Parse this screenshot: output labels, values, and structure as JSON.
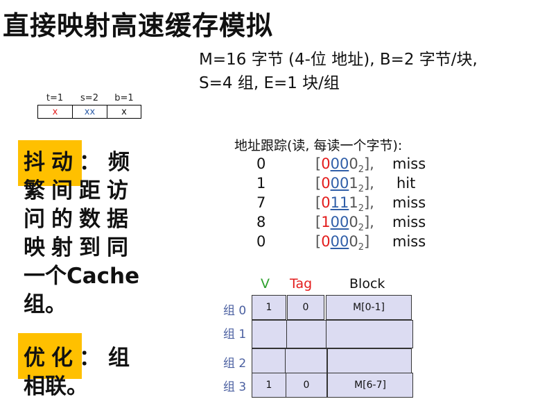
{
  "slide": {
    "title": "直接映射高速缓存模拟",
    "params_line1": "M=16 字节 (4-位 地址), B=2 字节/块,",
    "params_line2": "S=4 组, E=1 块/组"
  },
  "address_field": {
    "labels": [
      "t=1",
      "s=2",
      "b=1"
    ],
    "values": [
      "x",
      "xx",
      "x"
    ],
    "colors": [
      "#e31c1c",
      "#2f5ea8",
      "#111111"
    ]
  },
  "explanation": {
    "thrash_term": "抖动",
    "thrash_colon": "：",
    "thrash_lines": [
      "频",
      "繁间距访",
      "问的数据",
      "映射到同",
      "一个Cache",
      "组。"
    ],
    "opt_term": "优化",
    "opt_colon": "：",
    "opt_lines": [
      "组",
      "相联。"
    ]
  },
  "trace": {
    "header": "地址跟踪(读, 每读一个字节):",
    "rows": [
      {
        "dec": "0",
        "open": "[",
        "tag": "0",
        "set": "00",
        "off": "0",
        "base": "2",
        "close": "],",
        "result": "miss"
      },
      {
        "dec": "1",
        "open": "[",
        "tag": "0",
        "set": "00",
        "off": "1",
        "base": "2",
        "close": "],",
        "result": "hit"
      },
      {
        "dec": "7",
        "open": "[",
        "tag": "0",
        "set": "11",
        "off": "1",
        "base": "2",
        "close": "],",
        "result": "miss"
      },
      {
        "dec": "8",
        "open": "[",
        "tag": "1",
        "set": "00",
        "off": "0",
        "base": "2",
        "close": "],",
        "result": "miss"
      },
      {
        "dec": "0",
        "open": "[",
        "tag": "0",
        "set": "00",
        "off": "0",
        "base": "2",
        "close": "]",
        "result": "miss"
      }
    ]
  },
  "cache": {
    "headers": {
      "v": "V",
      "tag": "Tag",
      "block": "Block"
    },
    "header_colors": {
      "v": "#2ca02c",
      "tag": "#e31c1c",
      "block": "#111111"
    },
    "sets": [
      {
        "label": "组 0",
        "v": "1",
        "tag": "0",
        "block": "M[0-1]"
      },
      {
        "label": "组 1",
        "v": "",
        "tag": "",
        "block": ""
      },
      {
        "label": "组 2",
        "v": "",
        "tag": "",
        "block": ""
      },
      {
        "label": "组 3",
        "v": "1",
        "tag": "0",
        "block": "M[6-7]"
      }
    ]
  }
}
